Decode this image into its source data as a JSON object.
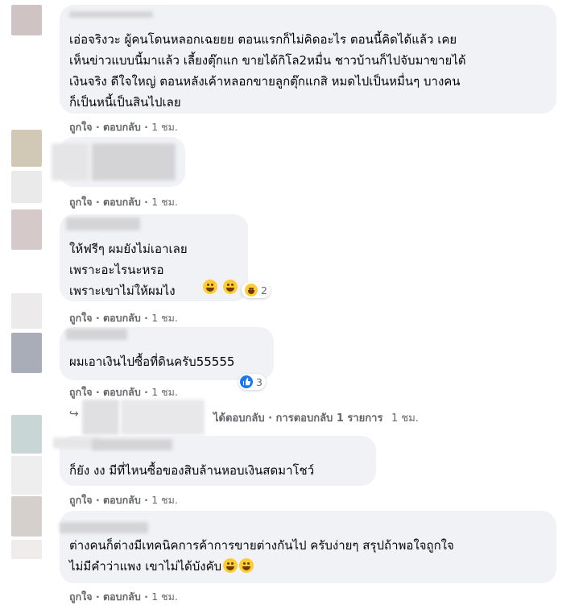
{
  "comments": [
    {
      "author": "",
      "text": "เอ่อจริงวะ ผู้คนโดนหลอกเฉยยย ตอนแรกก็ไม่คิดอะไร ตอนนี้คิดได้แล้ว เคย\nเห็นข่าวแบบนี้มาแล้ว เลี้ยงตุ๊กแก ขายได้กิโล2หมื่น ชาวบ้านก็ไปจับมาขายได้\nเงินจริง ดีใจใหญ่ ตอนหลังเค้าหลอกขายลูกตุ๊กแกสิ หมดไปเป็นหมื่นๆ บางคน\nก็เป็นหนี้เป็นสินไปเลย"
    },
    {
      "author": "",
      "text": ""
    },
    {
      "author": "",
      "text": "ให้ฟรีๆ ผมยังไม่เอาเลย\nเพราะอะไรนะหรอ\nเพราะเขาไม่ให้ผมไง",
      "reaction_icon": "laughing-emoji",
      "reaction_count": "2"
    },
    {
      "author": "",
      "text": "ผมเอาเงินไปซื้อที่ดินครับ55555",
      "reaction_icon": "like-thumb",
      "reaction_count": "3"
    },
    {
      "author": "",
      "text": "ก็ยัง งง มีที่ไหนซื้อของสิบล้านหอบเงินสดมาโชว์"
    },
    {
      "author": "",
      "text": "ต่างคนก็ต่างมีเทคนิคการค้าการขายต่างกันไป ครับง่ายๆ สรุปถ้าพอใจถูกใจ\nไม่มีคำว่าแพง เขาไม่ได้บังคับ"
    }
  ],
  "actions": {
    "like": "ถูกใจ",
    "reply": "ตอบกลับ",
    "dot": "·",
    "time": "1 ชม."
  },
  "reply_thread": {
    "text": "ได้ตอบกลับ · การตอบกลับ 1 รายการ",
    "time": "1 ชม."
  },
  "colors": {
    "bubble": "#f0f2f5",
    "secondary_text": "#65676b",
    "like_blue": "#1877f2",
    "emoji_yellow": "#ffcc33"
  }
}
